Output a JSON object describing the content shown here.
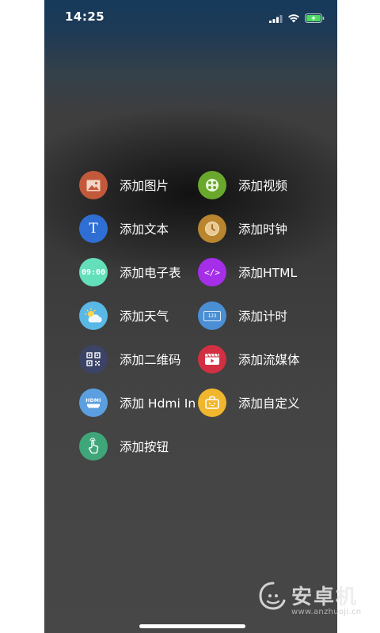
{
  "status_bar": {
    "time": "14:25"
  },
  "menu": {
    "items": [
      {
        "label": "添加图片",
        "icon": "image-icon",
        "color": "#c2593a"
      },
      {
        "label": "添加视频",
        "icon": "video-icon",
        "color": "#6aa82d"
      },
      {
        "label": "添加文本",
        "icon": "text-icon",
        "color": "#2f6fd4",
        "glyph": "T"
      },
      {
        "label": "添加时钟",
        "icon": "clock-icon",
        "color": "#b9852f"
      },
      {
        "label": "添加电子表",
        "icon": "digital-clock-icon",
        "color": "#63e0b9",
        "glyph": "09:00"
      },
      {
        "label": "添加HTML",
        "icon": "html-icon",
        "color": "#a52ee8",
        "glyph": "</>"
      },
      {
        "label": "添加天气",
        "icon": "weather-icon",
        "color": "#5ab8e6"
      },
      {
        "label": "添加计时",
        "icon": "timer-icon",
        "color": "#4a8fd4",
        "glyph": "123"
      },
      {
        "label": "添加二维码",
        "icon": "qr-code-icon",
        "color": "#3b4466"
      },
      {
        "label": "添加流媒体",
        "icon": "stream-media-icon",
        "color": "#d23042"
      },
      {
        "label": "添加 Hdmi In",
        "icon": "hdmi-icon",
        "color": "#5b9fe0",
        "glyph": "HDMI"
      },
      {
        "label": "添加自定义",
        "icon": "custom-icon",
        "color": "#f0b62d"
      },
      {
        "label": "添加按钮",
        "icon": "touch-button-icon",
        "color": "#3fa67a"
      }
    ]
  },
  "watermark": {
    "brand": "安卓机",
    "url": "www.anzhuoji.cn"
  }
}
